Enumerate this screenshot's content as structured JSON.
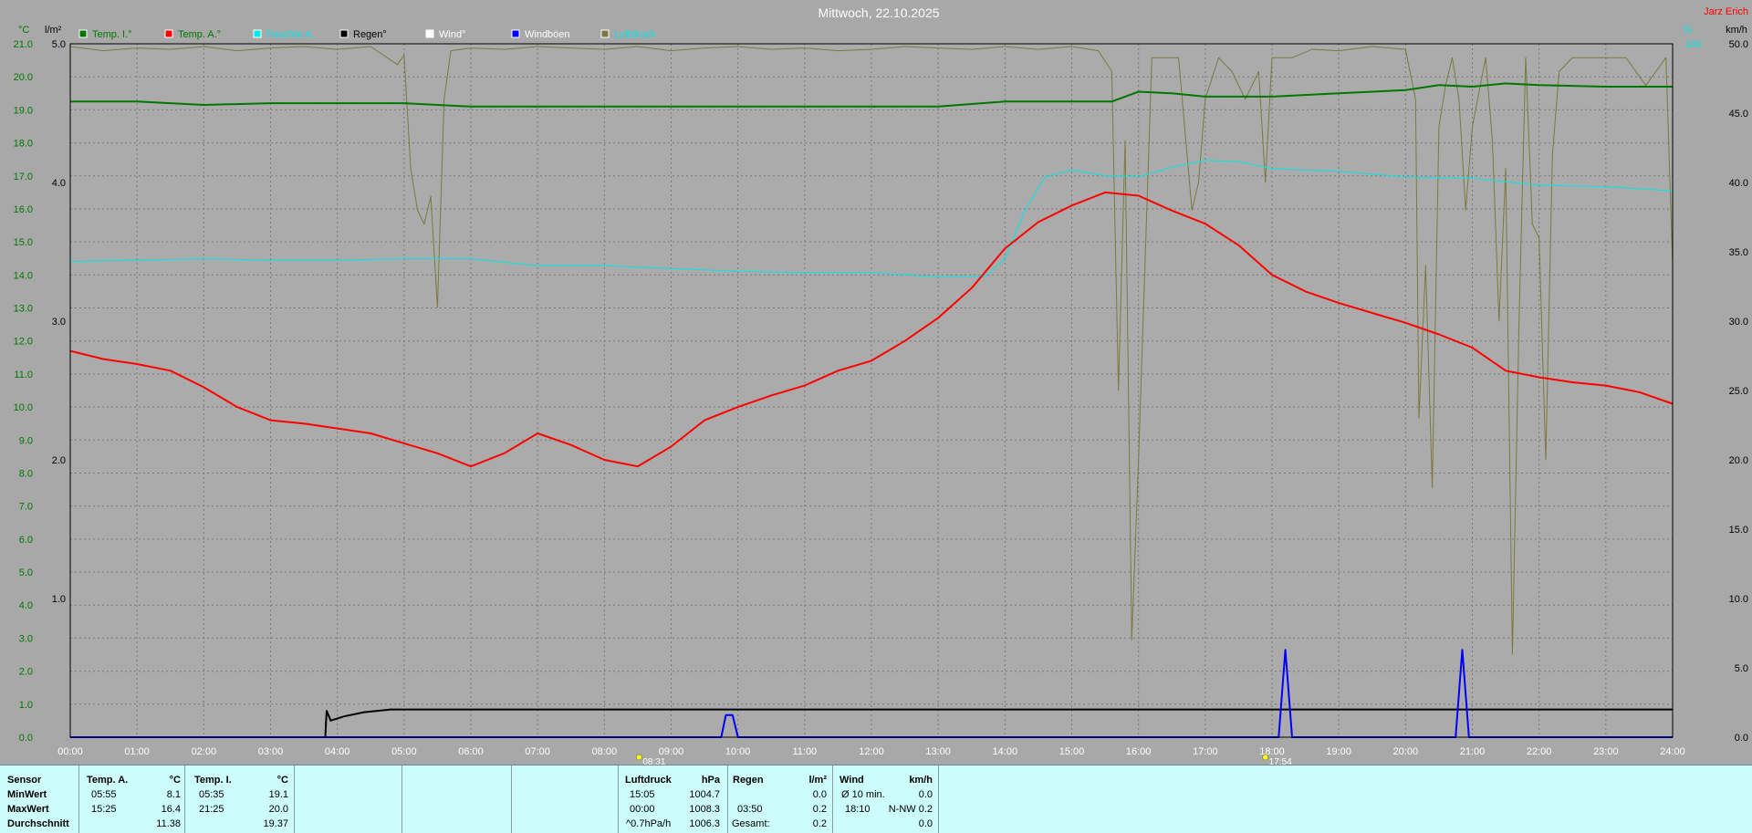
{
  "title": "Mittwoch, 22.10.2025",
  "author": "Jarz Erich",
  "colors": {
    "background": "#a8a8a8",
    "plot": "#ababab",
    "temp_inside": "#007800",
    "temp_outside": "#ff0000",
    "humidity": "#00e8e8",
    "rain": "#000000",
    "wind": "#ffffff",
    "gusts": "#0000ff",
    "pressure": "#7a7a40",
    "summary_bg": "#ccfcfc",
    "left_axis": "#007800",
    "right_axis": "#00e8e8"
  },
  "axes": {
    "left_temp_unit": "°C",
    "left_rain_unit": "l/m²",
    "right_pct_unit": "%",
    "right_wind_unit": "km/h",
    "temp_ticks": [
      "0.0",
      "1.0",
      "2.0",
      "3.0",
      "4.0",
      "5.0",
      "6.0",
      "7.0",
      "8.0",
      "9.0",
      "10.0",
      "11.0",
      "12.0",
      "13.0",
      "14.0",
      "15.0",
      "16.0",
      "17.0",
      "18.0",
      "19.0",
      "20.0",
      "21.0"
    ],
    "rain_ticks": [
      "1.0",
      "2.0",
      "3.0",
      "4.0",
      "5.0"
    ],
    "wind_ticks": [
      "0.0",
      "5.0",
      "10.0",
      "15.0",
      "20.0",
      "25.0",
      "30.0",
      "35.0",
      "40.0",
      "45.0",
      "50.0"
    ],
    "pct_ticks": [
      "100"
    ],
    "x_ticks": [
      "00:00",
      "01:00",
      "02:00",
      "03:00",
      "04:00",
      "05:00",
      "06:00",
      "07:00",
      "08:00",
      "09:00",
      "10:00",
      "11:00",
      "12:00",
      "13:00",
      "14:00",
      "15:00",
      "16:00",
      "17:00",
      "18:00",
      "19:00",
      "20:00",
      "21:00",
      "22:00",
      "23:00",
      "24:00"
    ]
  },
  "legend": [
    {
      "label": "Temp. I.°",
      "color": "#007800",
      "text_color": "#007800"
    },
    {
      "label": "Temp. A.°",
      "color": "#ff0000",
      "text_color": "#007800"
    },
    {
      "label": "Feuchte A.",
      "color": "#00e8e8",
      "text_color": "#00e8e8"
    },
    {
      "label": "Regen°",
      "color": "#000000",
      "text_color": "#000000"
    },
    {
      "label": "Wind°",
      "color": "#ffffff",
      "text_color": "#ffffff"
    },
    {
      "label": "Windböen",
      "color": "#0000ff",
      "text_color": "#ffffff"
    },
    {
      "label": "Luftdruck",
      "color": "#7a7a40",
      "text_color": "#00e8e8"
    }
  ],
  "markers": [
    {
      "label": "08:31",
      "hour": 8.52
    },
    {
      "label": "17:54",
      "hour": 17.9
    }
  ],
  "chart_data": {
    "type": "line",
    "x_unit": "hour",
    "x_range": [
      0,
      24
    ],
    "temp_range": [
      0,
      21
    ],
    "rain_range": [
      0,
      5
    ],
    "wind_range": [
      0,
      50
    ],
    "series": [
      {
        "name": "Temp. I.°",
        "axis": "temp",
        "color": "#007800",
        "x": [
          0,
          1,
          2,
          3,
          4,
          5,
          6,
          7,
          8,
          9,
          10,
          11,
          12,
          13,
          14,
          15,
          15.6,
          16,
          16.5,
          17,
          18,
          19,
          20,
          20.5,
          21,
          21.5,
          22,
          23,
          24
        ],
        "y": [
          19.25,
          19.25,
          19.15,
          19.2,
          19.2,
          19.2,
          19.1,
          19.1,
          19.1,
          19.1,
          19.1,
          19.1,
          19.1,
          19.1,
          19.25,
          19.25,
          19.25,
          19.55,
          19.5,
          19.4,
          19.4,
          19.5,
          19.6,
          19.75,
          19.7,
          19.8,
          19.75,
          19.7,
          19.7
        ]
      },
      {
        "name": "Temp. A.°",
        "axis": "temp",
        "color": "#ff0000",
        "x": [
          0,
          0.5,
          1,
          1.5,
          2,
          2.5,
          3,
          3.5,
          4,
          4.5,
          5,
          5.5,
          6,
          6.5,
          7,
          7.5,
          8,
          8.5,
          9,
          9.5,
          10,
          10.5,
          11,
          11.5,
          12,
          12.5,
          13,
          13.5,
          14,
          14.5,
          15,
          15.5,
          16,
          16.5,
          17,
          17.5,
          18,
          18.5,
          19,
          19.5,
          20,
          20.5,
          21,
          21.5,
          22,
          22.5,
          23,
          23.5,
          24
        ],
        "y": [
          11.7,
          11.45,
          11.3,
          11.1,
          10.6,
          10.0,
          9.6,
          9.5,
          9.35,
          9.2,
          8.9,
          8.6,
          8.2,
          8.6,
          9.2,
          8.85,
          8.4,
          8.2,
          8.8,
          9.6,
          10.0,
          10.35,
          10.65,
          11.1,
          11.4,
          12.0,
          12.7,
          13.6,
          14.8,
          15.6,
          16.1,
          16.5,
          16.4,
          15.95,
          15.55,
          14.9,
          14.0,
          13.5,
          13.15,
          12.85,
          12.55,
          12.2,
          11.8,
          11.1,
          10.9,
          10.75,
          10.65,
          10.45,
          10.1
        ]
      },
      {
        "name": "Feuchte A.",
        "axis": "wind",
        "color": "#00e8e8",
        "x": [
          0,
          1,
          2,
          3,
          4,
          5,
          6,
          7,
          8,
          9,
          10,
          11,
          12,
          13,
          13.7,
          14,
          14.3,
          14.6,
          15,
          15.5,
          16,
          16.5,
          17,
          17.5,
          18,
          19,
          20,
          21,
          22,
          23,
          24
        ],
        "y": [
          34.3,
          34.4,
          34.5,
          34.4,
          34.4,
          34.5,
          34.5,
          34.0,
          34.0,
          33.8,
          33.6,
          33.5,
          33.5,
          33.2,
          33.2,
          34.5,
          38.0,
          40.4,
          40.9,
          40.5,
          40.4,
          41.1,
          41.6,
          41.5,
          41.0,
          40.8,
          40.4,
          40.3,
          39.8,
          39.7,
          39.4
        ]
      },
      {
        "name": "Regen°",
        "axis": "rain",
        "color": "#000000",
        "x": [
          0,
          3.82,
          3.83,
          3.84,
          3.9,
          4.1,
          4.4,
          4.8,
          5.2,
          24
        ],
        "y": [
          0,
          0,
          0.1,
          0.19,
          0.12,
          0.15,
          0.18,
          0.2,
          0.2,
          0.2
        ]
      },
      {
        "name": "Windböen",
        "axis": "wind",
        "color": "#0000ff",
        "x": [
          0,
          9.75,
          9.82,
          9.92,
          10.0,
          10.02,
          18.1,
          18.2,
          18.3,
          20.75,
          20.85,
          20.95,
          24
        ],
        "y": [
          0,
          0,
          1.6,
          1.6,
          0,
          0,
          0,
          6.3,
          0,
          0,
          6.3,
          0,
          0
        ]
      },
      {
        "name": "Luftdruck",
        "axis": "wind",
        "color": "#7a7a40",
        "x": [
          0,
          0.5,
          1,
          1.5,
          2,
          2.5,
          3,
          3.5,
          4,
          4.5,
          4.9,
          5.0,
          5.1,
          5.2,
          5.3,
          5.4,
          5.5,
          5.6,
          5.7,
          6,
          6.5,
          7,
          7.5,
          8,
          8.5,
          9,
          9.5,
          10,
          10.5,
          11,
          11.5,
          12,
          12.5,
          13,
          13.5,
          14,
          14.5,
          15,
          15.4,
          15.6,
          15.7,
          15.8,
          15.9,
          16,
          16.2,
          16.6,
          16.8,
          16.9,
          17,
          17.2,
          17.4,
          17.6,
          17.8,
          17.9,
          18,
          18.3,
          18.6,
          19,
          19.5,
          20,
          20.15,
          20.2,
          20.3,
          20.4,
          20.5,
          20.6,
          20.7,
          20.8,
          20.9,
          21,
          21.2,
          21.3,
          21.4,
          21.5,
          21.6,
          21.7,
          21.8,
          21.9,
          22,
          22.1,
          22.2,
          22.3,
          22.5,
          22.8,
          23,
          23.3,
          23.6,
          23.9,
          24
        ],
        "y": [
          49.8,
          49.5,
          49.7,
          49.6,
          49.8,
          49.5,
          49.7,
          49.8,
          49.6,
          49.8,
          48.5,
          49.2,
          41,
          38,
          37,
          39,
          31,
          46,
          49.5,
          49.7,
          49.6,
          49.8,
          49.7,
          49.6,
          49.8,
          49.5,
          49.7,
          49.8,
          49.6,
          49.7,
          49.5,
          49.6,
          49.8,
          49.7,
          49.6,
          49.8,
          49.6,
          49.8,
          49.5,
          48,
          25,
          43,
          7,
          20,
          49,
          49,
          38,
          40,
          46,
          49,
          48,
          46,
          48,
          40,
          49,
          49,
          49.6,
          49.5,
          49.8,
          49.6,
          46,
          23,
          34,
          18,
          44,
          47,
          49,
          46,
          38,
          44,
          49,
          43,
          30,
          41,
          6,
          30,
          49,
          37,
          36,
          20,
          42,
          48,
          49,
          49,
          49,
          49,
          47,
          49,
          34
        ]
      }
    ]
  },
  "summary": {
    "row_labels": [
      "Sensor",
      "MinWert",
      "MaxWert",
      "Durchschnitt"
    ],
    "temp_a": {
      "header": "Temp. A.",
      "unit": "°C",
      "min_time": "05:55",
      "min": "8.1",
      "max_time": "15:25",
      "max": "16.4",
      "avg": "11.38"
    },
    "temp_i": {
      "header": "Temp. I.",
      "unit": "°C",
      "min_time": "05:35",
      "min": "19.1",
      "max_time": "21:25",
      "max": "20.0",
      "avg": "19.37"
    },
    "pressure": {
      "header": "Luftdruck",
      "unit": "hPa",
      "min_time": "15:05",
      "min": "1004.7",
      "max_time": "00:00",
      "max": "1008.3",
      "trend": "^0.7hPa/h",
      "avg": "1006.3"
    },
    "rain": {
      "header": "Regen",
      "unit": "l/m²",
      "min": "0.0",
      "max_time": "03:50",
      "max": "0.2",
      "total_label": "Gesamt:",
      "total": "0.2"
    },
    "wind": {
      "header": "Wind",
      "unit": "km/h",
      "avg_label": "Ø 10 min.",
      "avg": "0.0",
      "max_time": "18:10",
      "max": "N-NW 0.2",
      "third": "0.0"
    }
  }
}
